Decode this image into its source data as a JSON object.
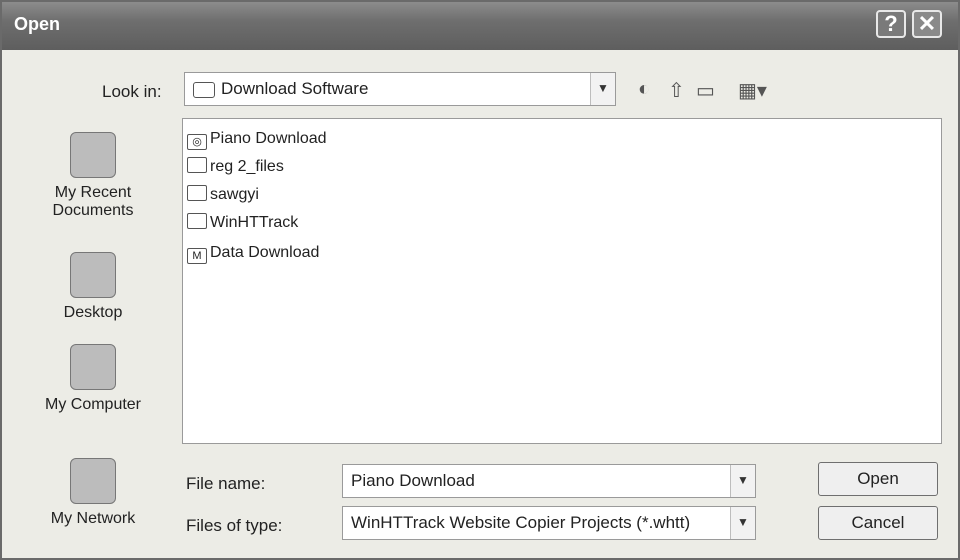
{
  "window": {
    "title": "Open",
    "help_label": "?",
    "close_label": "✕"
  },
  "look_in": {
    "label": "Look in:",
    "value": "Download Software"
  },
  "toolbar": {
    "back_icon": "back-circle",
    "up_icon": "up-folder",
    "new_folder_icon": "new-folder",
    "views_icon": "views-menu"
  },
  "places": [
    {
      "label": "My Recent\nDocuments",
      "icon": "clock-document-icon"
    },
    {
      "label": "Desktop",
      "icon": "desktop-icon"
    },
    {
      "label": "My Computer",
      "icon": "computer-icon"
    },
    {
      "label": "My Network",
      "icon": "network-icon"
    }
  ],
  "files": [
    {
      "name": "Piano Download",
      "icon": "file-icon"
    },
    {
      "name": "reg 2_files",
      "icon": "folder-icon"
    },
    {
      "name": "sawgyi",
      "icon": "folder-icon"
    },
    {
      "name": "WinHTTrack",
      "icon": "folder-icon"
    },
    {
      "name": "Data  Download",
      "icon": "document-icon"
    }
  ],
  "file_name": {
    "label": "File name:",
    "value": "Piano Download"
  },
  "file_type": {
    "label": "Files of type:",
    "value": "WinHTTrack Website Copier Projects (*.whtt)"
  },
  "buttons": {
    "open": "Open",
    "cancel": "Cancel"
  }
}
